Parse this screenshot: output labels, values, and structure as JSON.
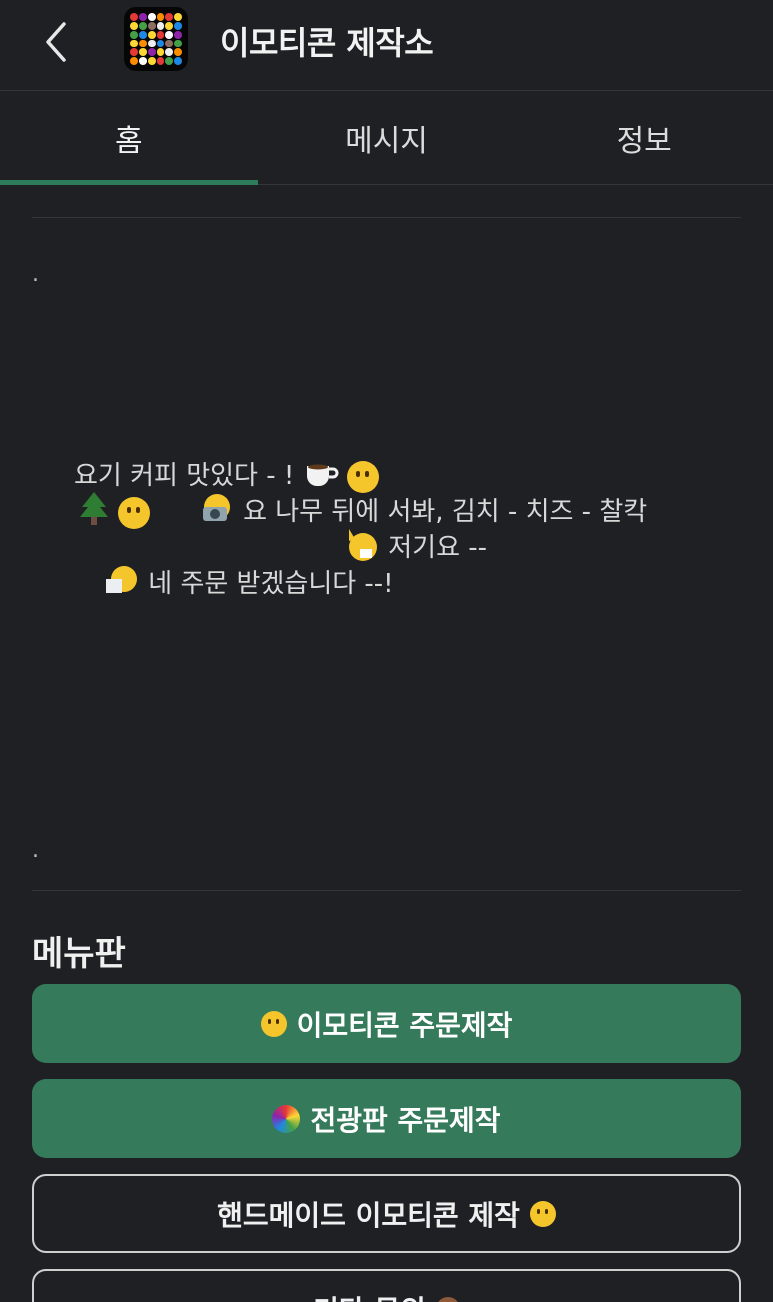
{
  "header": {
    "title": "이모티콘 제작소",
    "back_icon": "chevron-left-icon"
  },
  "tabs": [
    {
      "label": "홈",
      "active": true
    },
    {
      "label": "메시지",
      "active": false
    },
    {
      "label": "정보",
      "active": false
    }
  ],
  "intro": {
    "dot_top": ".",
    "dot_bottom": ".",
    "lines": [
      "요기 커피 맛있다 - !",
      "요 나무 뒤에 서봐, 김치 - 치즈 - 찰칵",
      "저기요 --",
      "네 주문 받겠습니다 --!"
    ]
  },
  "menu": {
    "title": "메뉴판",
    "buttons": [
      {
        "label": "이모티콘 주문제작",
        "style": "filled"
      },
      {
        "label": "전광판 주문제작",
        "style": "filled"
      },
      {
        "label": "핸드메이드 이모티콘 제작",
        "style": "outline"
      },
      {
        "label": "기타 문의",
        "style": "outline"
      }
    ]
  },
  "colors": {
    "background": "#1f2024",
    "accent": "#357a5b",
    "tab_indicator": "#2e7d5a"
  }
}
